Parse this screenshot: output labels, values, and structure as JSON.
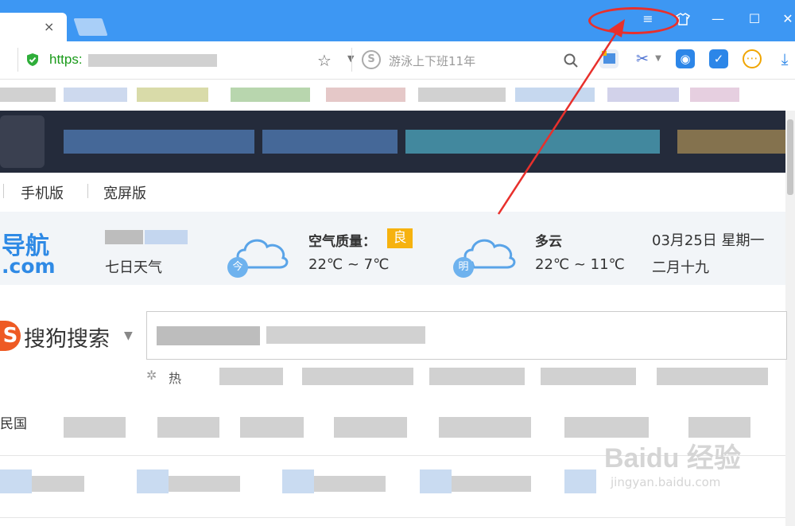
{
  "titlebar": {
    "close_tab": "×",
    "menu_icon": "≡",
    "minimize": "—",
    "maximize": "☐",
    "close": "✕"
  },
  "addressbar": {
    "url_prefix": "https:",
    "search_placeholder": "游泳上下班11年"
  },
  "mode_links": [
    "手机版",
    "宽屏版"
  ],
  "weather": {
    "logo_top": "导航",
    "logo_bottom": ".com",
    "seven_day": "七日天气",
    "air_quality_label": "空气质量：",
    "air_quality_value": "良",
    "today_badge": "今",
    "today_temp": "22℃ ~ 7℃",
    "tomorrow_badge": "明",
    "tomorrow_condition": "多云",
    "tomorrow_temp": "22℃ ~ 11℃",
    "date": "03月25日 星期一",
    "lunar_date": "二月十九"
  },
  "search": {
    "engine_name": "搜狗搜索",
    "hot_prefix": "热"
  },
  "nav": {
    "first_item": "民国"
  },
  "watermark": {
    "brand": "Baidu 经验",
    "url": "jingyan.baidu.com"
  },
  "colors": {
    "titlebar": "#3d97f3",
    "annotation": "#e8302c",
    "url_green": "#1a9a1a",
    "air_badge": "#f6b20f",
    "logo_blue": "#2f8ae5"
  }
}
